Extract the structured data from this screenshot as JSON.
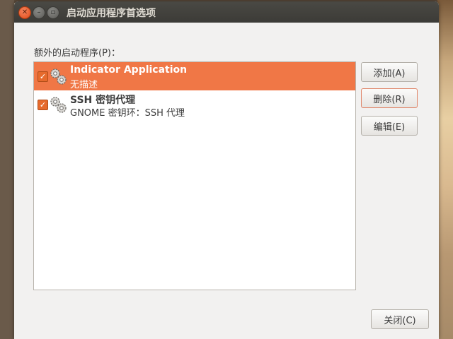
{
  "window": {
    "title": "启动应用程序首选项",
    "controls": {
      "close_icon": "close-icon",
      "minimize_icon": "minimize-icon",
      "maximize_icon": "maximize-icon"
    }
  },
  "section_label": "额外的启动程序(P)：",
  "startup_programs": [
    {
      "name": "Indicator Application",
      "description": "无描述",
      "enabled": true,
      "selected": true,
      "icon": "gears-icon"
    },
    {
      "name": "SSH 密钥代理",
      "description": "GNOME 密钥环：SSH 代理",
      "enabled": true,
      "selected": false,
      "icon": "gears-icon"
    }
  ],
  "buttons": {
    "add": "添加(A)",
    "remove": "删除(R)",
    "edit": "编辑(E)",
    "close": "关闭(C)"
  },
  "colors": {
    "accent": "#f07746",
    "titlebar": "#3c3b37",
    "checkbox": "#e66a2c"
  }
}
